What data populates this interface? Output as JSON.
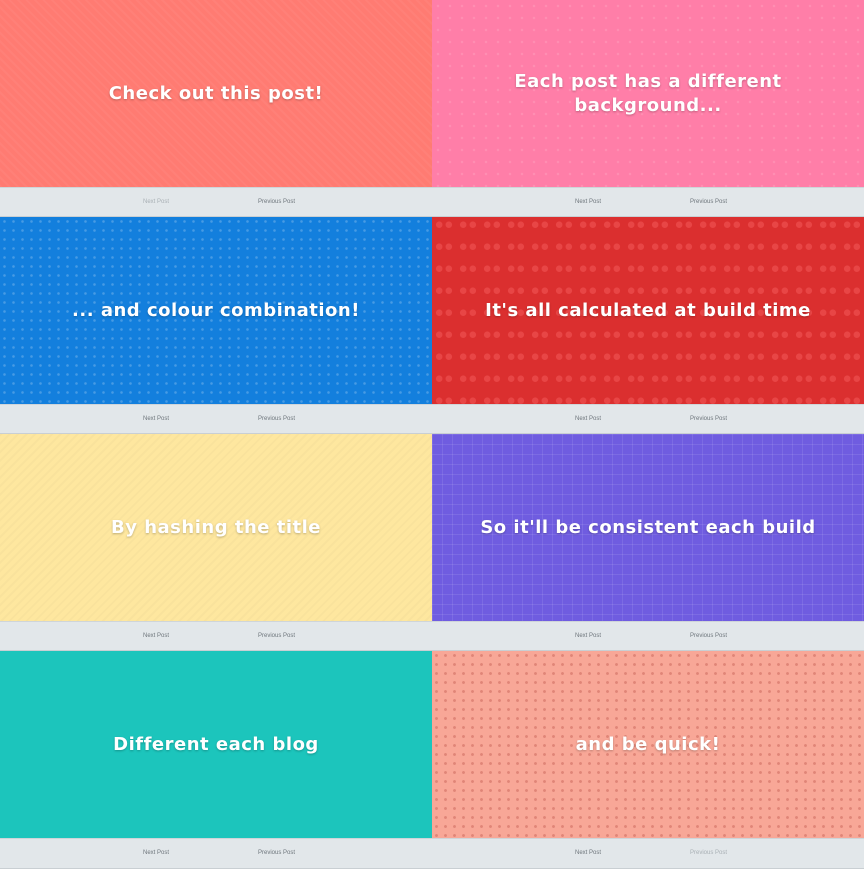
{
  "cards": [
    {
      "title": "Check out this post!",
      "next_label": "Next Post",
      "prev_label": "Previous Post",
      "next_disabled": true,
      "prev_disabled": false
    },
    {
      "title": "Each post has a different background...",
      "next_label": "Next Post",
      "prev_label": "Previous Post",
      "next_disabled": false,
      "prev_disabled": false
    },
    {
      "title": "... and colour combination!",
      "next_label": "Next Post",
      "prev_label": "Previous Post",
      "next_disabled": false,
      "prev_disabled": false
    },
    {
      "title": "It's all calculated at build time",
      "next_label": "Next Post",
      "prev_label": "Previous Post",
      "next_disabled": false,
      "prev_disabled": false
    },
    {
      "title": "By hashing the title",
      "next_label": "Next Post",
      "prev_label": "Previous Post",
      "next_disabled": false,
      "prev_disabled": false
    },
    {
      "title": "So it'll be consistent each build",
      "next_label": "Next Post",
      "prev_label": "Previous Post",
      "next_disabled": false,
      "prev_disabled": false
    },
    {
      "title": "Different each blog",
      "next_label": "Next Post",
      "prev_label": "Previous Post",
      "next_disabled": false,
      "prev_disabled": false
    },
    {
      "title": "and be quick!",
      "next_label": "Next Post",
      "prev_label": "Previous Post",
      "next_disabled": false,
      "prev_disabled": true
    }
  ],
  "colors": {
    "backgrounds": [
      "#ff7b72",
      "#ff7ea8",
      "#137fdd",
      "#db2f2f",
      "#fee79f",
      "#6f5ce0",
      "#1cc5bc",
      "#f8a797"
    ],
    "nav_bar": "#e2e7ea",
    "title_text": "#ffffff"
  }
}
